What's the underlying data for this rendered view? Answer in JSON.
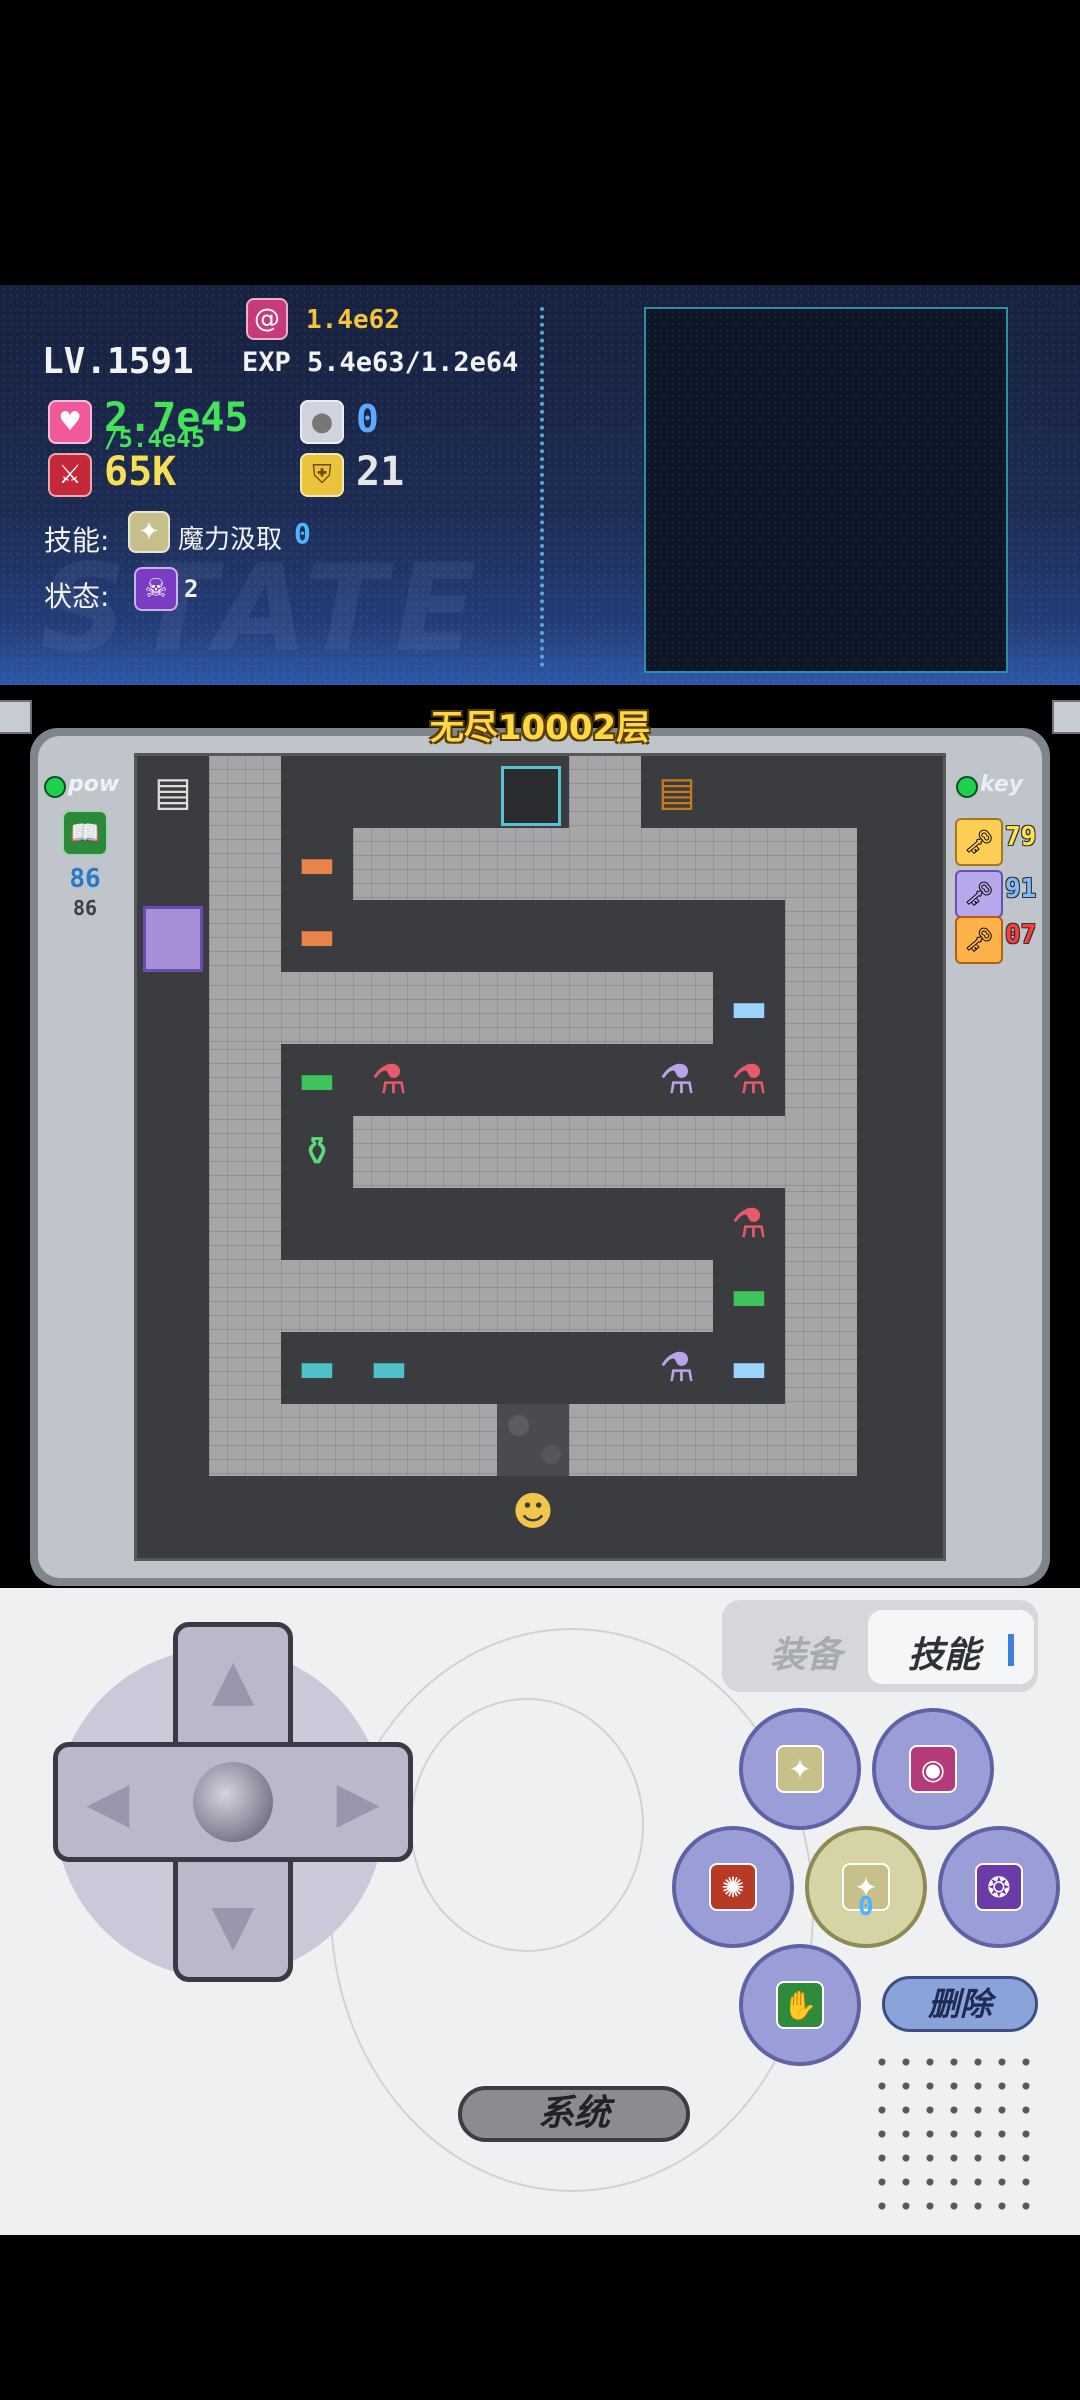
{
  "status": {
    "magic_value": "1.4e62",
    "level": "LV.1591",
    "exp": "EXP 5.4e63/1.2e64",
    "hp": "2.7e45",
    "hp_max": "/5.4e45",
    "orb_count": "0",
    "attack": "65K",
    "defense": "21",
    "skill_label": "技能:",
    "skill_name": "魔力汲取",
    "skill_count": "0",
    "state_label": "状态:",
    "state_count": "2",
    "bg_text": "STATE"
  },
  "floor": {
    "title": "无尽10002层"
  },
  "pow_panel": {
    "label": "pow",
    "value": "86",
    "sub_value": "86"
  },
  "key_panel": {
    "label": "key",
    "keys": [
      {
        "name": "yellow-key",
        "count": "79",
        "color": "#ffe14a"
      },
      {
        "name": "blue-key",
        "count": "91",
        "color": "#7fb9ff"
      },
      {
        "name": "red-key",
        "count": "07",
        "color": "#ff3a3a"
      }
    ]
  },
  "controls": {
    "tab_equip": "装备",
    "tab_skill": "技能",
    "skill_slot_count": "0",
    "delete_label": "删除",
    "system_label": "系统"
  },
  "colors": {
    "hp": "#44e35a",
    "level_text": "#f2f2f2",
    "floor_title": "#ffd845",
    "skill_count": "#4fb4ff"
  }
}
